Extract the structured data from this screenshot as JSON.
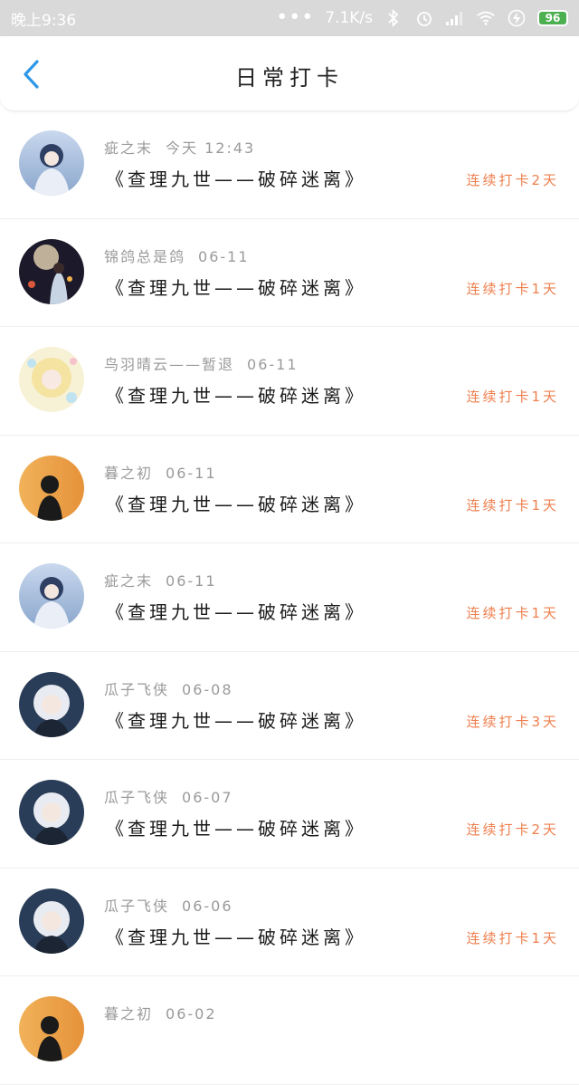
{
  "status_bar": {
    "time": "晚上9:36",
    "speed": "7.1K/s",
    "battery": "96"
  },
  "header": {
    "title": "日常打卡",
    "back_icon": "chevron-left-icon"
  },
  "colors": {
    "accent_back": "#2e97e6",
    "streak": "#ee7f4d",
    "meta": "#9a9a9a"
  },
  "entries": [
    {
      "name": "疵之末",
      "date": "今天 12:43",
      "book": "《查理九世——破碎迷离》",
      "streak": "连续打卡2天"
    },
    {
      "name": "锦鸽总是鸽",
      "date": "06-11",
      "book": "《查理九世——破碎迷离》",
      "streak": "连续打卡1天"
    },
    {
      "name": "鸟羽晴云——暂退",
      "date": "06-11",
      "book": "《查理九世——破碎迷离》",
      "streak": "连续打卡1天"
    },
    {
      "name": "暮之初",
      "date": "06-11",
      "book": "《查理九世——破碎迷离》",
      "streak": "连续打卡1天"
    },
    {
      "name": "疵之末",
      "date": "06-11",
      "book": "《查理九世——破碎迷离》",
      "streak": "连续打卡1天"
    },
    {
      "name": "瓜子飞侠",
      "date": "06-08",
      "book": "《查理九世——破碎迷离》",
      "streak": "连续打卡3天"
    },
    {
      "name": "瓜子飞侠",
      "date": "06-07",
      "book": "《查理九世——破碎迷离》",
      "streak": "连续打卡2天"
    },
    {
      "name": "瓜子飞侠",
      "date": "06-06",
      "book": "《查理九世——破碎迷离》",
      "streak": "连续打卡1天"
    },
    {
      "name": "暮之初",
      "date": "06-02",
      "book": "",
      "streak": ""
    }
  ]
}
